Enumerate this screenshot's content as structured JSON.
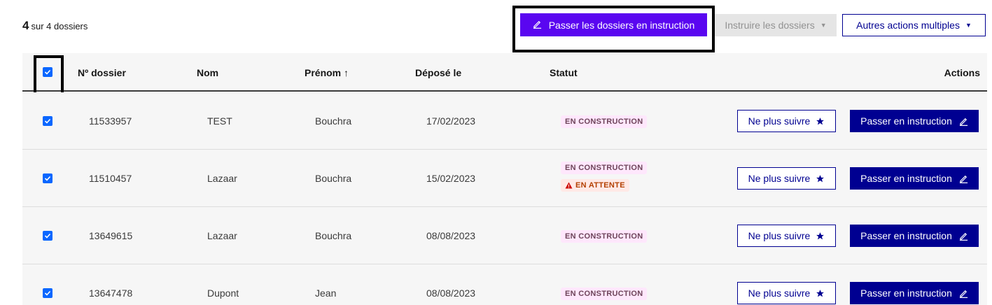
{
  "summary": {
    "count": "4",
    "label": "sur 4 dossiers"
  },
  "toolbar": {
    "passer_label": "Passer les dossiers en instruction",
    "instruire_label": "Instruire les dossiers",
    "autres_label": "Autres actions multiples"
  },
  "table": {
    "headers": {
      "numero": "Nº dossier",
      "nom": "Nom",
      "prenom": "Prénom ↑",
      "depose": "Déposé le",
      "statut": "Statut",
      "actions": "Actions"
    },
    "rows": [
      {
        "numero": "11533957",
        "nom": "TEST",
        "prenom": "Bouchra",
        "depose": "17/02/2023",
        "statut": "EN CONSTRUCTION",
        "statut2": "",
        "follow": "Ne plus suivre",
        "instr": "Passer en instruction"
      },
      {
        "numero": "11510457",
        "nom": "Lazaar",
        "prenom": "Bouchra",
        "depose": "15/02/2023",
        "statut": "EN CONSTRUCTION",
        "statut2": "EN ATTENTE",
        "follow": "Ne plus suivre",
        "instr": "Passer en instruction"
      },
      {
        "numero": "13649615",
        "nom": "Lazaar",
        "prenom": "Bouchra",
        "depose": "08/08/2023",
        "statut": "EN CONSTRUCTION",
        "statut2": "",
        "follow": "Ne plus suivre",
        "instr": "Passer en instruction"
      },
      {
        "numero": "13647478",
        "nom": "Dupont",
        "prenom": "Jean",
        "depose": "08/08/2023",
        "statut": "EN CONSTRUCTION",
        "statut2": "",
        "follow": "Ne plus suivre",
        "instr": "Passer en instruction"
      }
    ]
  },
  "colors": {
    "primary_blue": "#000091",
    "violet": "#5a06f0",
    "checkbox": "#0a67ff"
  },
  "icons": {
    "edit": "pencil-icon",
    "star": "star-icon",
    "warning": "warning-icon",
    "caret": "caret-down-icon",
    "check": "checkmark-icon"
  }
}
